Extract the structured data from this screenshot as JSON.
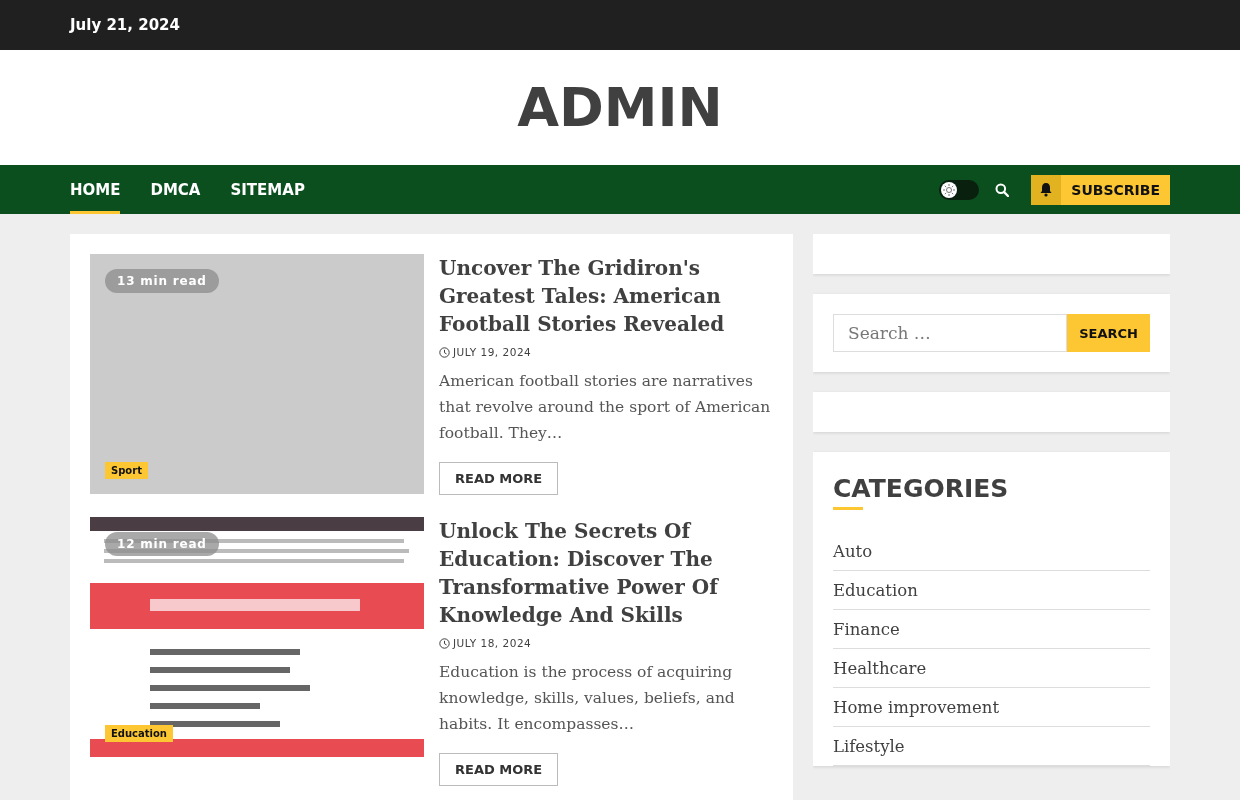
{
  "top_bar": {
    "date": "July 21, 2024"
  },
  "header": {
    "site_title": "ADMIN"
  },
  "nav": {
    "items": [
      {
        "label": "HOME",
        "selected": true
      },
      {
        "label": "DMCA",
        "selected": false
      },
      {
        "label": "SITEMAP",
        "selected": false
      }
    ],
    "dark_mode": false,
    "subscribe": "SUBSCRIBE"
  },
  "articles": [
    {
      "read_time": "13 min read",
      "category": "Sport",
      "image": {
        "kind": "placeholder"
      },
      "title": "Uncover The Gridiron's Greatest Tales: American Football Stories Revealed",
      "date": "JULY 19, 2024",
      "excerpt": "American football stories are narratives that revolve around the sport of American football. They…",
      "button": "READ MORE"
    },
    {
      "read_time": "12 min read",
      "category": "Education",
      "title": "Unlock The Secrets Of Education: Discover The Transformative Power Of Knowledge And Skills",
      "date": "JULY 18, 2024",
      "excerpt": "Education is the process of acquiring knowledge, skills, values, beliefs, and habits. It encompasses…",
      "button": "READ MORE"
    }
  ],
  "sidebar": {
    "search": {
      "placeholder": "Search …",
      "button": "SEARCH"
    },
    "categories": {
      "title": "CATEGORIES",
      "items": [
        "Auto",
        "Education",
        "Finance",
        "Healthcare",
        "Home improvement",
        "Lifestyle"
      ]
    }
  }
}
